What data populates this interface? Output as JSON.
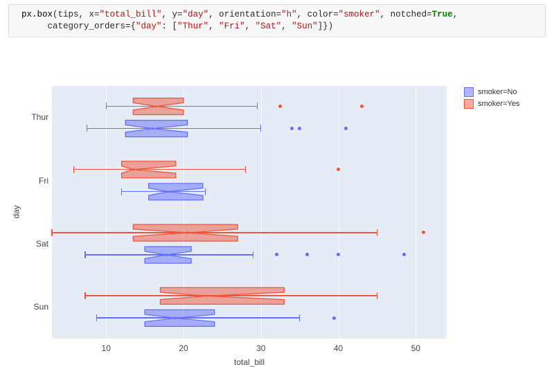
{
  "code": {
    "fn": "px.box",
    "open": "(tips, x=",
    "x_val": "\"total_bill\"",
    "sep1": ", y=",
    "y_val": "\"day\"",
    "sep2": ", orientation=",
    "orient_val": "\"h\"",
    "sep3": ", color=",
    "color_val": "\"smoker\"",
    "sep4": ", notched=",
    "notched_val": "True",
    "sep5": ",",
    "line2a": "     category_orders={",
    "co_key": "\"day\"",
    "co_mid": ": [",
    "co_v1": "\"Thur\"",
    "co_c1": ", ",
    "co_v2": "\"Fri\"",
    "co_c2": ", ",
    "co_v3": "\"Sat\"",
    "co_c3": ", ",
    "co_v4": "\"Sun\"",
    "co_end": "]})"
  },
  "axes": {
    "x_title": "total_bill",
    "y_title": "day",
    "x_ticks": [
      "10",
      "20",
      "30",
      "40",
      "50"
    ],
    "y_ticks": [
      "Thur",
      "Fri",
      "Sat",
      "Sun"
    ]
  },
  "legend": {
    "items": [
      {
        "label": "smoker=No",
        "fill": "#636efa"
      },
      {
        "label": "smoker=Yes",
        "fill": "#ef553b"
      }
    ]
  },
  "colors": {
    "no": {
      "fill": "#636efa",
      "line": "#636efa"
    },
    "yes": {
      "fill": "#ef553b",
      "line": "#ef553b"
    }
  },
  "chart_data": {
    "type": "box",
    "orientation": "h",
    "notched": true,
    "xlabel": "total_bill",
    "ylabel": "day",
    "xlim": [
      3,
      54
    ],
    "categories": [
      "Thur",
      "Fri",
      "Sat",
      "Sun"
    ],
    "color_by": "smoker",
    "series": [
      {
        "name": "smoker=Yes",
        "color": "#ef553b",
        "boxes": {
          "Thur": {
            "q1": 13.5,
            "median": 16.5,
            "q3": 20.0,
            "whisker_low": 10.0,
            "whisker_high": 29.5,
            "outliers": [
              32.5,
              43.0
            ]
          },
          "Fri": {
            "q1": 12.0,
            "median": 13.5,
            "q3": 19.0,
            "whisker_low": 5.8,
            "whisker_high": 28.0,
            "outliers": [
              40.0
            ]
          },
          "Sat": {
            "q1": 13.5,
            "median": 20.5,
            "q3": 27.0,
            "whisker_low": 3.0,
            "whisker_high": 45.0,
            "outliers": [
              51.0
            ]
          },
          "Sun": {
            "q1": 17.0,
            "median": 23.0,
            "q3": 33.0,
            "whisker_low": 7.3,
            "whisker_high": 45.0,
            "outliers": []
          }
        }
      },
      {
        "name": "smoker=No",
        "color": "#636efa",
        "boxes": {
          "Thur": {
            "q1": 12.5,
            "median": 16.0,
            "q3": 20.5,
            "whisker_low": 7.5,
            "whisker_high": 30.0,
            "outliers": [
              34.0,
              35.0,
              41.0
            ]
          },
          "Fri": {
            "q1": 15.5,
            "median": 18.0,
            "q3": 22.5,
            "whisker_low": 12.0,
            "whisker_high": 22.8,
            "outliers": []
          },
          "Sat": {
            "q1": 15.0,
            "median": 17.8,
            "q3": 21.0,
            "whisker_low": 7.3,
            "whisker_high": 29.0,
            "outliers": [
              32.0,
              36.0,
              40.0,
              48.5
            ]
          },
          "Sun": {
            "q1": 15.0,
            "median": 19.0,
            "q3": 24.0,
            "whisker_low": 8.8,
            "whisker_high": 35.0,
            "outliers": [
              39.5
            ]
          }
        }
      }
    ]
  }
}
